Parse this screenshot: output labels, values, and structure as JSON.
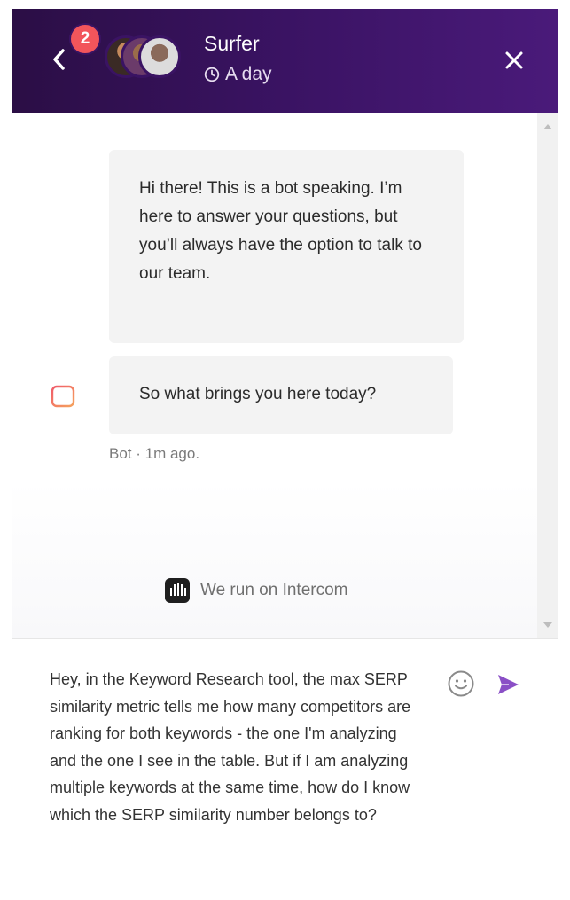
{
  "header": {
    "unread_count": "2",
    "title": "Surfer",
    "status": "A day"
  },
  "messages": [
    {
      "text": "Hi there! This is a bot speaking. I’m here to answer your questions, but you’ll always have the option to talk to our team."
    },
    {
      "text": "So what brings you here today?"
    }
  ],
  "meta": {
    "text": "Bot · 1m ago."
  },
  "powered_by": {
    "text": "We run on Intercom"
  },
  "composer": {
    "value": "Hey, in the Keyword Research tool, the max SERP similarity metric tells me how many competitors are ranking for both keywords  - the one I'm analyzing and the one I see in the table. But if I am analyzing multiple keywords at the same time, how do I know which the SERP similarity number belongs to?"
  },
  "colors": {
    "header_bg": "#3a1363",
    "badge": "#f2555b",
    "send": "#8a4fc6",
    "bot_icon": "#f05b6a"
  }
}
